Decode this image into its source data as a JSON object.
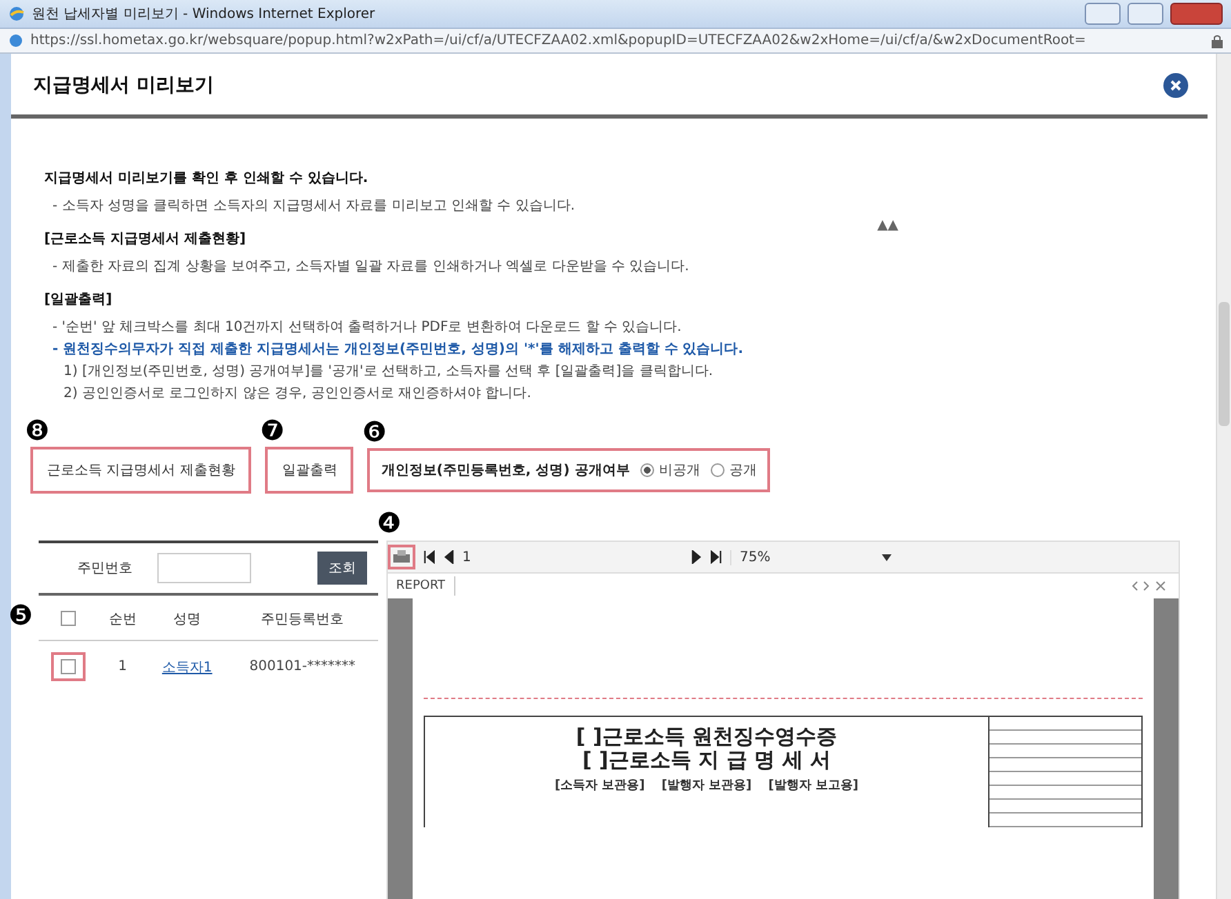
{
  "window": {
    "title": "원천 납세자별 미리보기 - Windows Internet Explorer",
    "address": "https://ssl.hometax.go.kr/websquare/popup.html?w2xPath=/ui/cf/a/UTECFZAA02.xml&popupID=UTECFZAA02&w2xHome=/ui/cf/a/&w2xDocumentRoot="
  },
  "dialog": {
    "title": "지급명세서 미리보기"
  },
  "notes": [
    {
      "kind": "heading",
      "text": "지급명세서 미리보기를 확인 후 인쇄할 수 있습니다."
    },
    {
      "kind": "detail",
      "text": "- 소득자 성명을 클릭하면 소득자의 지급명세서 자료를 미리보고 인쇄할 수 있습니다."
    },
    {
      "kind": "heading",
      "text": "[근로소득 지급명세서 제출현황]"
    },
    {
      "kind": "detail",
      "text": "- 제출한 자료의 집계 상황을 보여주고, 소득자별 일괄 자료를 인쇄하거나 엑셀로 다운받을 수 있습니다."
    },
    {
      "kind": "heading",
      "text": "[일괄출력]"
    },
    {
      "kind": "detail",
      "text": "- '순번' 앞 체크박스를 최대 10건까지 선택하여 출력하거나 PDF로 변환하여 다운로드 할 수 있습니다."
    },
    {
      "kind": "highlight",
      "text": "- 원천징수의무자가 직접 제출한 지급명세서는 개인정보(주민번호, 성명)의 '*'를 해제하고 출력할 수 있습니다."
    },
    {
      "kind": "step",
      "text": "1) [개인정보(주민번호, 성명) 공개여부]를 '공개'로 선택하고, 소득자를 선택 후 [일괄출력]을 클릭합니다."
    },
    {
      "kind": "step",
      "text": "2) 공인인증서로 로그인하지 않은 경우, 공인인증서로 재인증하셔야 합니다."
    }
  ],
  "collapse_toggle": "▲▲",
  "actions": {
    "buttons": [
      {
        "marker": "❽",
        "label": "근로소득 지급명세서 제출현황"
      },
      {
        "marker": "❼",
        "label": "일괄출력"
      }
    ],
    "privacy": {
      "marker": "❻",
      "label": "개인정보(주민등록번호, 성명) 공개여부",
      "options": [
        {
          "label": "비공개",
          "selected": true
        },
        {
          "label": "공개",
          "selected": false
        }
      ]
    }
  },
  "search": {
    "label": "주민번호",
    "button": "조회"
  },
  "table": {
    "marker": "❺",
    "select_all_checked": false,
    "columns": [
      "순번",
      "성명",
      "주민등록번호"
    ],
    "rows": [
      {
        "checked": false,
        "number": "1",
        "name": "소득자1",
        "id_number": "800101-*******"
      }
    ]
  },
  "viewer": {
    "marker": "❹",
    "page": "1",
    "zoom": "75%",
    "tab": "REPORT",
    "document": {
      "titles": [
        "[ ]근로소득 원천징수영수증",
        "[ ]근로소득 지 급 명 세 서"
      ],
      "copies": [
        "[소득자 보관용]",
        "[발행자 보관용]",
        "[발행자 보고용]"
      ]
    }
  }
}
